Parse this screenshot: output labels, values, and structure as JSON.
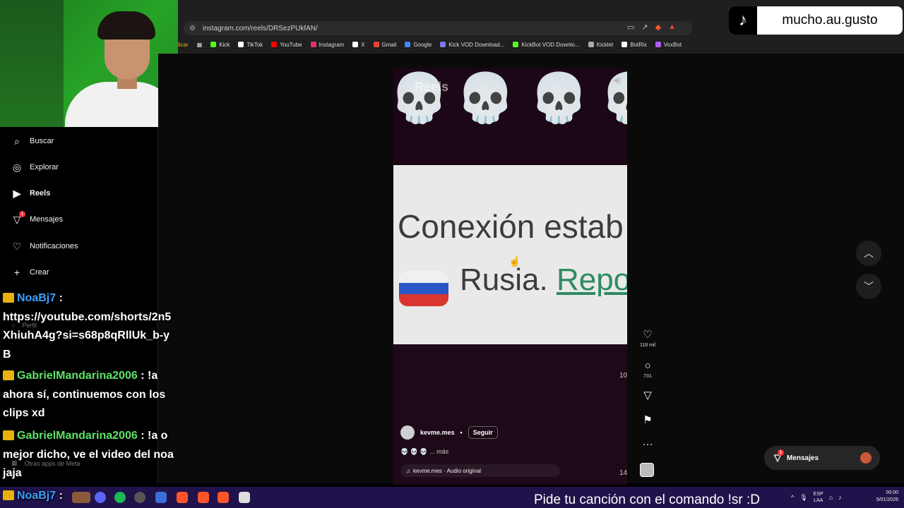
{
  "browser": {
    "url": "instagram.com/reels/DRSezPUkfAN/",
    "bookmarks": [
      "Kick",
      "TikTok",
      "YouTube",
      "Instagram",
      "X",
      "Gmail",
      "Google",
      "Kick VOD Download...",
      "KickBot VOD Downlo...",
      "Kicklet",
      "BotRix",
      "VoxBot"
    ],
    "bookmark_colors": [
      "#53fc18",
      "#ffffff",
      "#ff0000",
      "#e1306c",
      "#ffffff",
      "#ea4335",
      "#4285f4",
      "#7a7aff",
      "#53fc18",
      "#aaaaaa",
      "#ffffff",
      "#b05cff"
    ],
    "bookmark_prefix": "licar"
  },
  "tiktok_badge": {
    "icon": "tiktok-icon",
    "handle": "mucho.au.gusto"
  },
  "sidebar": {
    "items": [
      {
        "label": "Buscar",
        "icon": "search-icon"
      },
      {
        "label": "Explorar",
        "icon": "compass-icon"
      },
      {
        "label": "Reels",
        "icon": "reels-icon"
      },
      {
        "label": "Mensajes",
        "icon": "messages-icon",
        "badge": "1"
      },
      {
        "label": "Notificaciones",
        "icon": "heart-icon"
      },
      {
        "label": "Crear",
        "icon": "plus-icon"
      }
    ],
    "hidden_items": [
      "Perfil",
      "Otras apps de Meta"
    ]
  },
  "chat": {
    "messages": [
      {
        "user": "NoaBj7",
        "text": "https://youtube.com/shorts/2n5XhiuhA4g?si=s68p8qRllUk_b-yB"
      },
      {
        "user": "GabrielMandarina2006",
        "text": "!a ahora sí, continuemos con los clips xd"
      },
      {
        "user": "GabrielMandarina2006",
        "text": "!a o mejor dicho, ve el video del noa jaja"
      },
      {
        "user": "NoaBj7",
        "text": ""
      }
    ],
    "separator": ":"
  },
  "reel": {
    "header_label": "Reels",
    "card_line1": "Conexión estab",
    "card_line2_text": "Rusia. ",
    "card_line2_link": "Repo",
    "author": "kevme.mes",
    "bullet": "•",
    "follow": "Seguir",
    "caption": "💀 💀 💀 ... más",
    "audio": "kevme.mes · Audio original",
    "side_numbers": [
      "10",
      "14"
    ],
    "skull": "💀"
  },
  "actions": {
    "likes": "118 mil",
    "comments": "731"
  },
  "messages_pill": {
    "label": "Mensajes",
    "badge": "1"
  },
  "taskbar": {
    "marquee": "Pide tu canción con el comando !sr :D",
    "lang_top": "ESP",
    "lang_bottom": "LAA",
    "time": "00:00",
    "date": "5/01/2026"
  }
}
